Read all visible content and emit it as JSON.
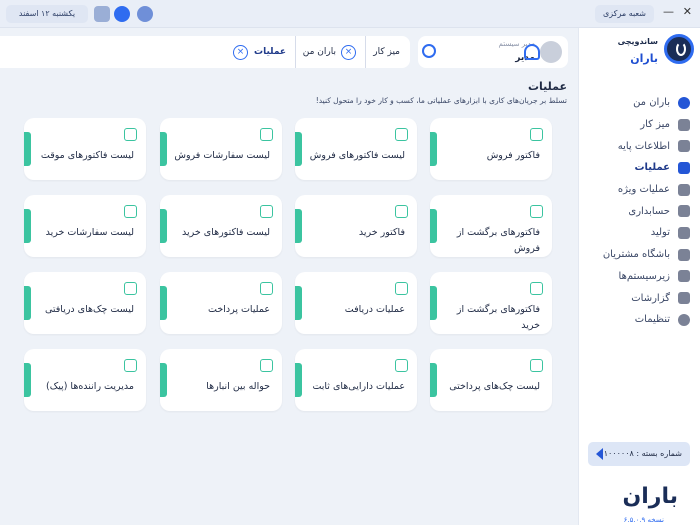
{
  "topbar": {
    "branch_label": "شعبه مرکزی",
    "date_label": "یکشنبه ۱۲ اسفند",
    "close_glyph": "✕",
    "minimize_glyph": "—",
    "help_icon": "question-icon",
    "support_icon": "headset-icon",
    "lock_icon": "lock-icon",
    "accent_color": "#2f6cf0"
  },
  "sidebar": {
    "brand_subtitle": "ساندویچی",
    "brand_name": "باران",
    "items": [
      {
        "label": "باران من",
        "icon": "baran-logo-icon",
        "active": false
      },
      {
        "label": "میز کار",
        "icon": "home-icon",
        "active": false
      },
      {
        "label": "اطلاعات پایه",
        "icon": "folder-icon",
        "active": false
      },
      {
        "label": "عملیات",
        "icon": "grid-icon",
        "active": true
      },
      {
        "label": "عملیات ویژه",
        "icon": "grid-plus-icon",
        "active": false
      },
      {
        "label": "حسابداری",
        "icon": "calculator-icon",
        "active": false
      },
      {
        "label": "تولید",
        "icon": "box-icon",
        "active": false
      },
      {
        "label": "باشگاه مشتریان",
        "icon": "users-icon",
        "active": false
      },
      {
        "label": "زیرسیستم‌ها",
        "icon": "layers-icon",
        "active": false
      },
      {
        "label": "گزارشات",
        "icon": "bar-chart-icon",
        "active": false
      },
      {
        "label": "تنظیمات",
        "icon": "gear-icon",
        "active": false
      }
    ],
    "package_label": "شماره بسته : ۱۰۰۰۰۰۸",
    "bottom_logo": "باران",
    "version": "نسخه ۶.۵.۰.۹",
    "collapse_glyph": "›"
  },
  "user": {
    "role": "مدیر سیستم",
    "name": "مدیر"
  },
  "tabs": [
    {
      "label": "میز کار"
    },
    {
      "label": "باران من"
    },
    {
      "label": "عملیات"
    }
  ],
  "page": {
    "title": "عملیات",
    "description": "تسلط بر جریان‌های کاری با ابزارهای عملیاتی ما، کسب و کار خود را متحول کنید!"
  },
  "cards": [
    {
      "label": "فاکتور فروش",
      "icon": "invoice-icon"
    },
    {
      "label": "لیست فاکتورهای فروش",
      "icon": "invoice-list-icon"
    },
    {
      "label": "لیست سفارشات فروش",
      "icon": "basket-icon"
    },
    {
      "label": "لیست فاکتورهای موقت",
      "icon": "document-icon"
    },
    {
      "label": "فاکتورهای برگشت از فروش",
      "icon": "return-icon"
    },
    {
      "label": "فاکتور خرید",
      "icon": "receipt-icon"
    },
    {
      "label": "لیست فاکتورهای خرید",
      "icon": "cart-icon"
    },
    {
      "label": "لیست سفارشات خرید",
      "icon": "cart-icon"
    },
    {
      "label": "فاکتورهای برگشت از خرید",
      "icon": "return-icon"
    },
    {
      "label": "عملیات دریافت",
      "icon": "wallet-in-icon"
    },
    {
      "label": "عملیات پرداخت",
      "icon": "wallet-out-icon"
    },
    {
      "label": "لیست چک‌های دریافتی",
      "icon": "cheque-icon"
    },
    {
      "label": "لیست چک‌های پرداختی",
      "icon": "cheque-icon"
    },
    {
      "label": "عملیات دارایی‌های ثابت",
      "icon": "clipboard-icon"
    },
    {
      "label": "حواله بین انبارها",
      "icon": "transfer-icon"
    },
    {
      "label": "مدیریت راننده‌ها (پیک)",
      "icon": "scooter-icon"
    }
  ]
}
